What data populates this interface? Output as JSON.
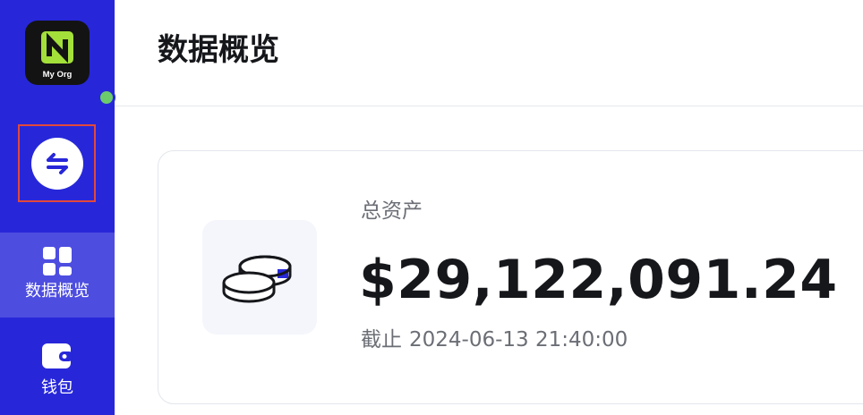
{
  "sidebar": {
    "org": {
      "name": "My Org",
      "logo_icon": "org-logo-icon",
      "status_color": "#6ccc6c"
    },
    "switch_button": {
      "icon": "swap-arrows-icon"
    },
    "items": [
      {
        "label": "数据概览",
        "icon": "dashboard-grid-icon",
        "active": true
      },
      {
        "label": "钱包",
        "icon": "wallet-icon",
        "active": false
      }
    ]
  },
  "header": {
    "title": "数据概览"
  },
  "asset_card": {
    "label": "总资产",
    "value": "$29,122,091.24",
    "as_of_prefix": "截止",
    "as_of_time": "2024-06-13 21:40:00",
    "icon": "coins-icon"
  },
  "colors": {
    "sidebar_bg": "#2727d9",
    "accent": "#2727d9",
    "highlight_border": "#e2493b",
    "logo_accent": "#a4e03a"
  }
}
